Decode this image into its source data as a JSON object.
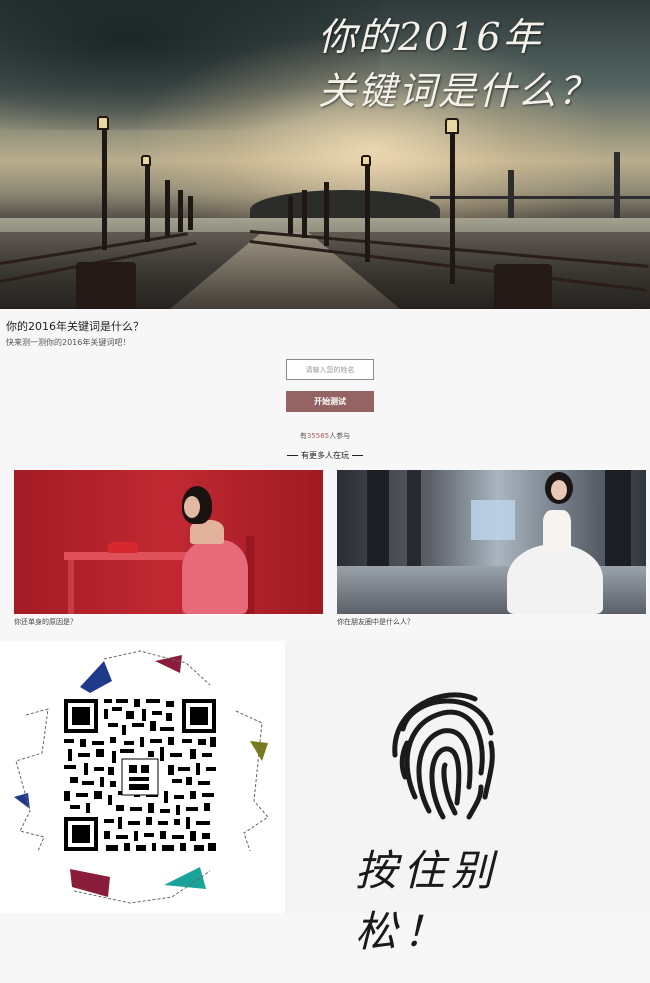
{
  "hero": {
    "title_line1": "你的2016年",
    "title_line2": "关键词是什么？"
  },
  "intro": {
    "title": "你的2016年关键词是什么？",
    "subtitle": "快来测一测你的2016年关键词吧！"
  },
  "form": {
    "name_placeholder": "请输入您的姓名",
    "start_label": "开始测试"
  },
  "stats": {
    "prefix": "有",
    "count": "35565",
    "suffix": "人参与"
  },
  "more": {
    "heading": "有更多人在玩"
  },
  "cards": [
    {
      "caption": "你还单身的原因是？",
      "image": "woman-red-table-photo"
    },
    {
      "caption": "你在朋友圈中是什么人？",
      "image": "bride-white-gown-photo"
    }
  ],
  "qr": {
    "image": "qr-code",
    "accent_colors": [
      "#1f3a8a",
      "#8a1d3c",
      "#1aa39a",
      "#7a7a1a"
    ]
  },
  "fingerprint": {
    "icon": "fingerprint-icon",
    "hold_text": "按住别松！"
  }
}
